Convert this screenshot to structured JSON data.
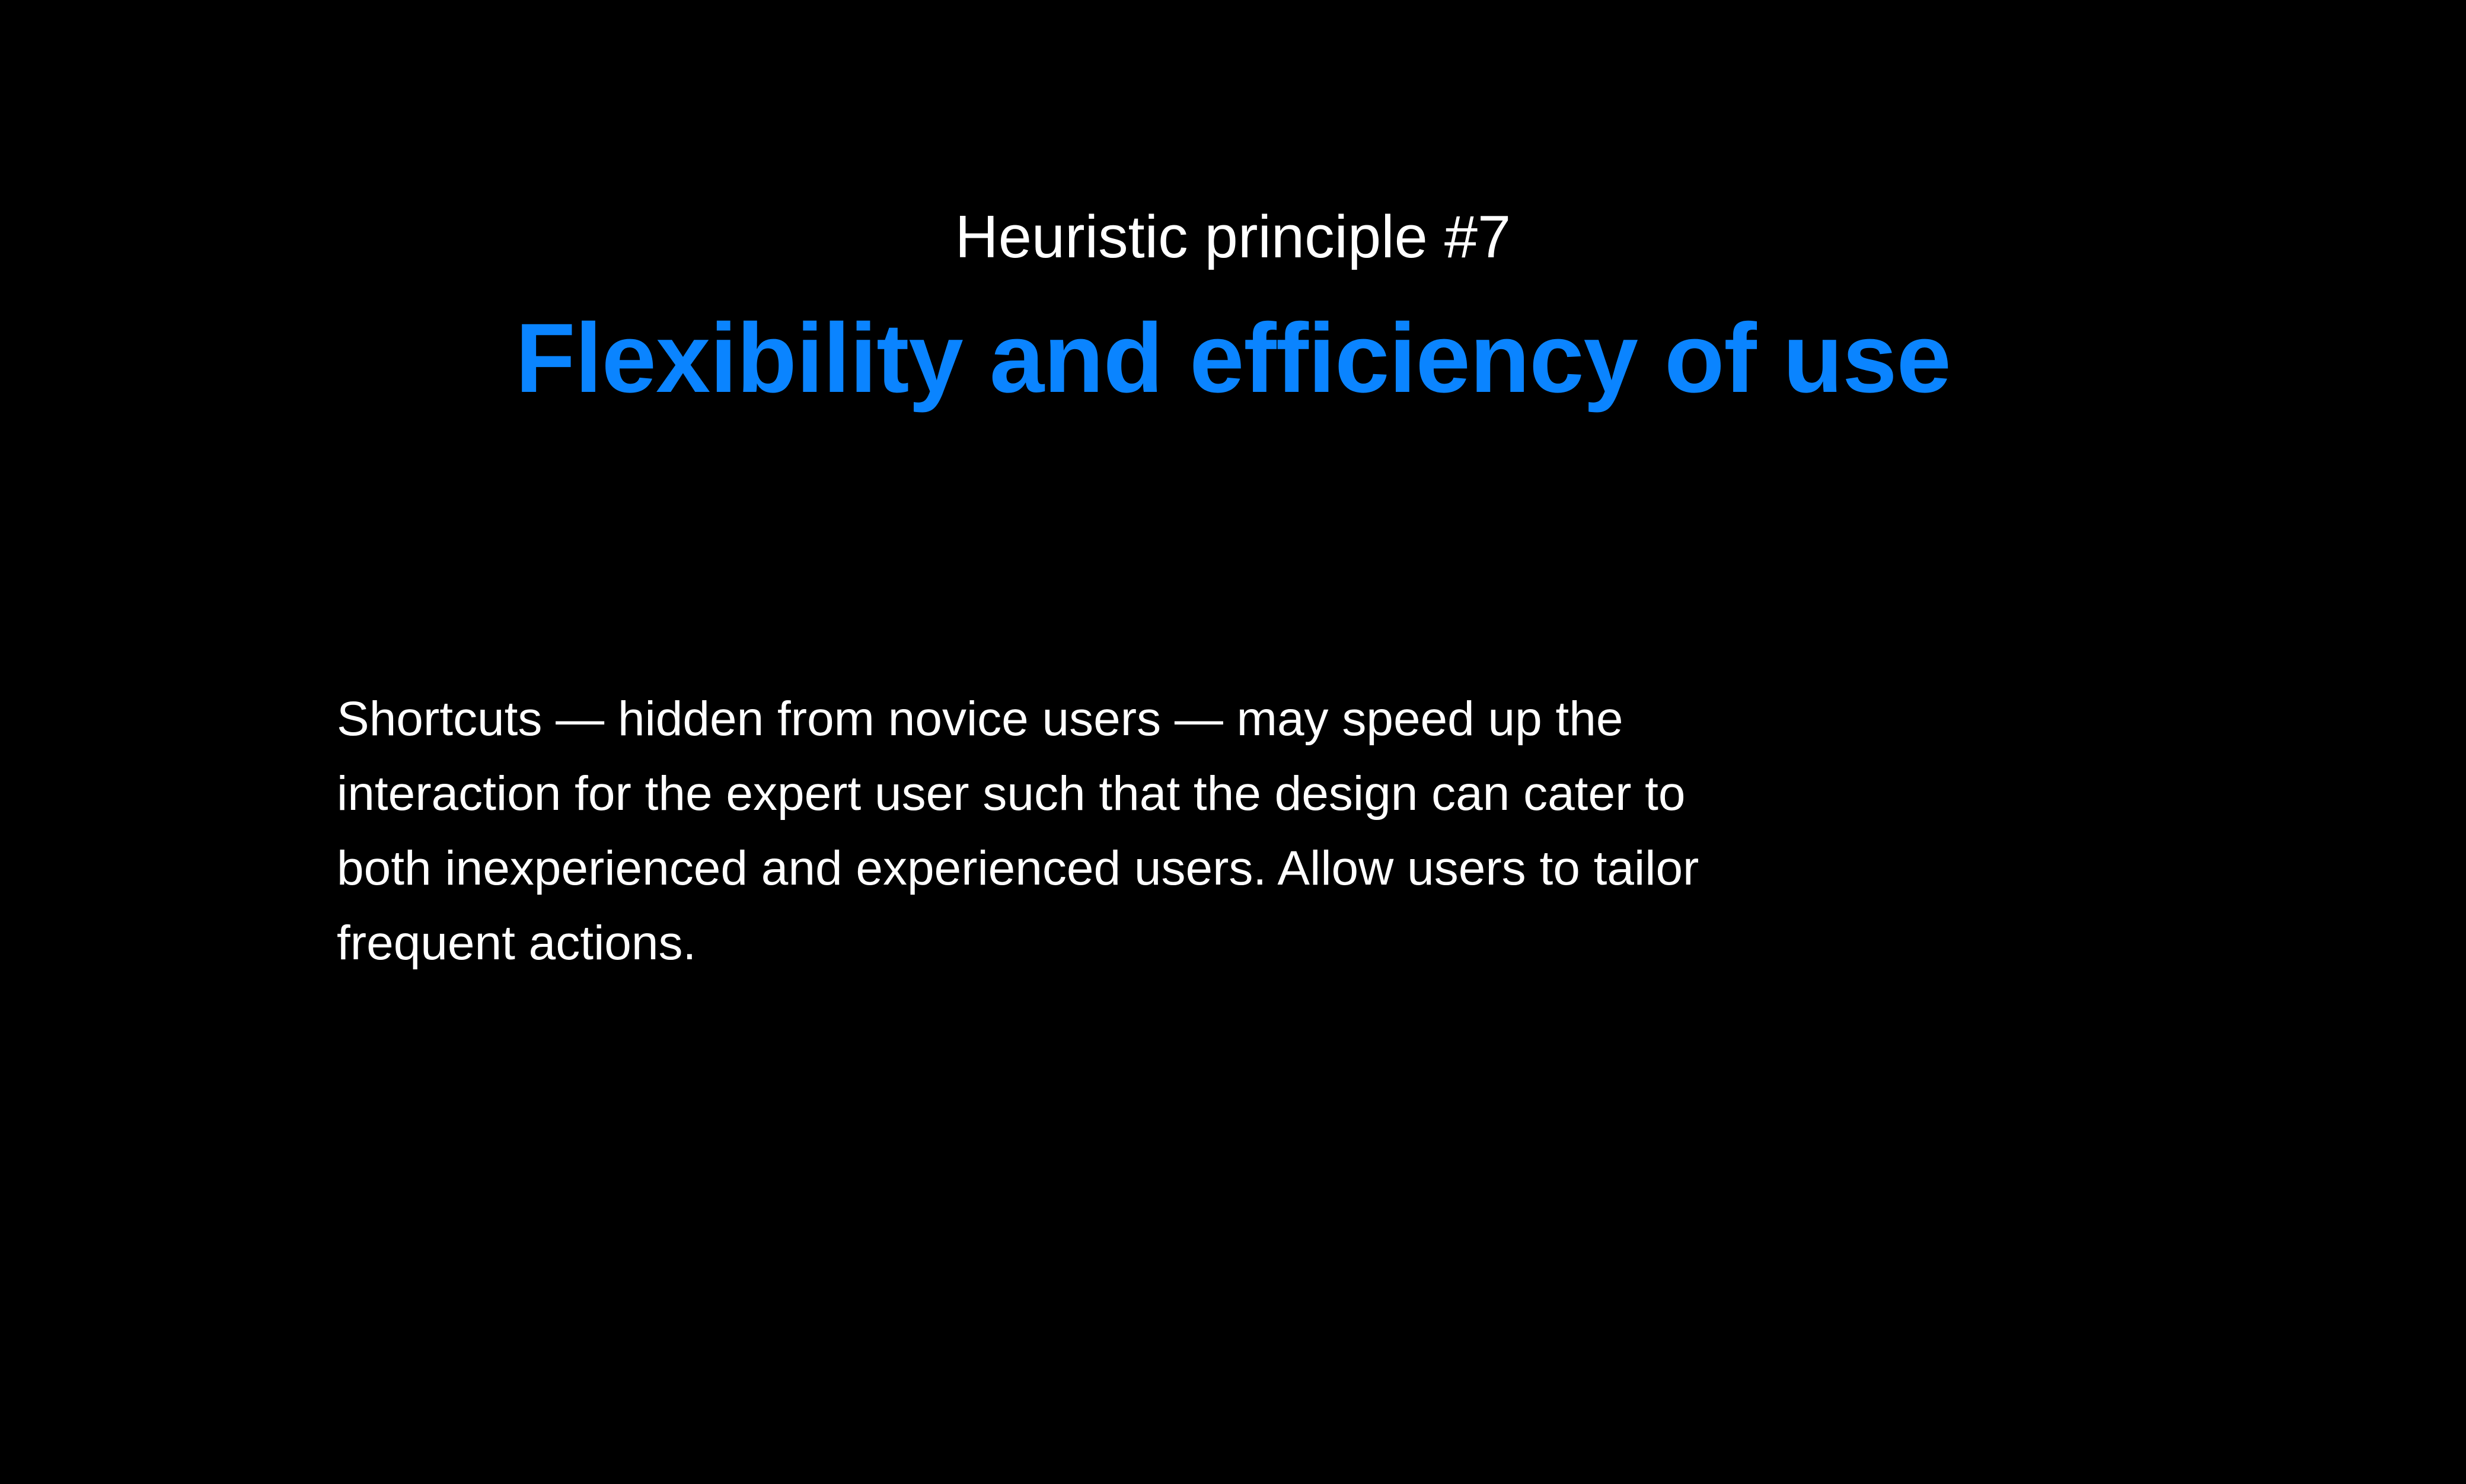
{
  "slide": {
    "eyebrow": "Heuristic principle #7",
    "title": "Flexibility and efficiency of use",
    "body_lines": [
      "Shortcuts — hidden from novice users — may speed up the",
      "interaction for the expert user such that the design can cater to",
      "both inexperienced and experienced users. Allow users to tailor",
      "frequent actions."
    ]
  },
  "colors": {
    "background": "#000000",
    "text": "#ffffff",
    "accent": "#0a84ff"
  }
}
